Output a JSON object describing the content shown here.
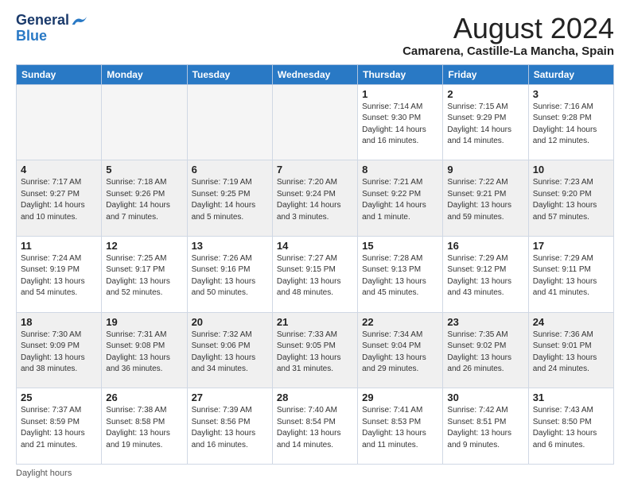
{
  "header": {
    "logo_general": "General",
    "logo_blue": "Blue",
    "month_title": "August 2024",
    "location": "Camarena, Castille-La Mancha, Spain"
  },
  "days_of_week": [
    "Sunday",
    "Monday",
    "Tuesday",
    "Wednesday",
    "Thursday",
    "Friday",
    "Saturday"
  ],
  "footer": {
    "label": "Daylight hours"
  },
  "weeks": [
    [
      {
        "day": "",
        "empty": true
      },
      {
        "day": "",
        "empty": true
      },
      {
        "day": "",
        "empty": true
      },
      {
        "day": "",
        "empty": true
      },
      {
        "day": "1",
        "sunrise": "7:14 AM",
        "sunset": "9:30 PM",
        "daylight": "14 hours and 16 minutes."
      },
      {
        "day": "2",
        "sunrise": "7:15 AM",
        "sunset": "9:29 PM",
        "daylight": "14 hours and 14 minutes."
      },
      {
        "day": "3",
        "sunrise": "7:16 AM",
        "sunset": "9:28 PM",
        "daylight": "14 hours and 12 minutes."
      }
    ],
    [
      {
        "day": "4",
        "sunrise": "7:17 AM",
        "sunset": "9:27 PM",
        "daylight": "14 hours and 10 minutes."
      },
      {
        "day": "5",
        "sunrise": "7:18 AM",
        "sunset": "9:26 PM",
        "daylight": "14 hours and 7 minutes."
      },
      {
        "day": "6",
        "sunrise": "7:19 AM",
        "sunset": "9:25 PM",
        "daylight": "14 hours and 5 minutes."
      },
      {
        "day": "7",
        "sunrise": "7:20 AM",
        "sunset": "9:24 PM",
        "daylight": "14 hours and 3 minutes."
      },
      {
        "day": "8",
        "sunrise": "7:21 AM",
        "sunset": "9:22 PM",
        "daylight": "14 hours and 1 minute."
      },
      {
        "day": "9",
        "sunrise": "7:22 AM",
        "sunset": "9:21 PM",
        "daylight": "13 hours and 59 minutes."
      },
      {
        "day": "10",
        "sunrise": "7:23 AM",
        "sunset": "9:20 PM",
        "daylight": "13 hours and 57 minutes."
      }
    ],
    [
      {
        "day": "11",
        "sunrise": "7:24 AM",
        "sunset": "9:19 PM",
        "daylight": "13 hours and 54 minutes."
      },
      {
        "day": "12",
        "sunrise": "7:25 AM",
        "sunset": "9:17 PM",
        "daylight": "13 hours and 52 minutes."
      },
      {
        "day": "13",
        "sunrise": "7:26 AM",
        "sunset": "9:16 PM",
        "daylight": "13 hours and 50 minutes."
      },
      {
        "day": "14",
        "sunrise": "7:27 AM",
        "sunset": "9:15 PM",
        "daylight": "13 hours and 48 minutes."
      },
      {
        "day": "15",
        "sunrise": "7:28 AM",
        "sunset": "9:13 PM",
        "daylight": "13 hours and 45 minutes."
      },
      {
        "day": "16",
        "sunrise": "7:29 AM",
        "sunset": "9:12 PM",
        "daylight": "13 hours and 43 minutes."
      },
      {
        "day": "17",
        "sunrise": "7:29 AM",
        "sunset": "9:11 PM",
        "daylight": "13 hours and 41 minutes."
      }
    ],
    [
      {
        "day": "18",
        "sunrise": "7:30 AM",
        "sunset": "9:09 PM",
        "daylight": "13 hours and 38 minutes."
      },
      {
        "day": "19",
        "sunrise": "7:31 AM",
        "sunset": "9:08 PM",
        "daylight": "13 hours and 36 minutes."
      },
      {
        "day": "20",
        "sunrise": "7:32 AM",
        "sunset": "9:06 PM",
        "daylight": "13 hours and 34 minutes."
      },
      {
        "day": "21",
        "sunrise": "7:33 AM",
        "sunset": "9:05 PM",
        "daylight": "13 hours and 31 minutes."
      },
      {
        "day": "22",
        "sunrise": "7:34 AM",
        "sunset": "9:04 PM",
        "daylight": "13 hours and 29 minutes."
      },
      {
        "day": "23",
        "sunrise": "7:35 AM",
        "sunset": "9:02 PM",
        "daylight": "13 hours and 26 minutes."
      },
      {
        "day": "24",
        "sunrise": "7:36 AM",
        "sunset": "9:01 PM",
        "daylight": "13 hours and 24 minutes."
      }
    ],
    [
      {
        "day": "25",
        "sunrise": "7:37 AM",
        "sunset": "8:59 PM",
        "daylight": "13 hours and 21 minutes."
      },
      {
        "day": "26",
        "sunrise": "7:38 AM",
        "sunset": "8:58 PM",
        "daylight": "13 hours and 19 minutes."
      },
      {
        "day": "27",
        "sunrise": "7:39 AM",
        "sunset": "8:56 PM",
        "daylight": "13 hours and 16 minutes."
      },
      {
        "day": "28",
        "sunrise": "7:40 AM",
        "sunset": "8:54 PM",
        "daylight": "13 hours and 14 minutes."
      },
      {
        "day": "29",
        "sunrise": "7:41 AM",
        "sunset": "8:53 PM",
        "daylight": "13 hours and 11 minutes."
      },
      {
        "day": "30",
        "sunrise": "7:42 AM",
        "sunset": "8:51 PM",
        "daylight": "13 hours and 9 minutes."
      },
      {
        "day": "31",
        "sunrise": "7:43 AM",
        "sunset": "8:50 PM",
        "daylight": "13 hours and 6 minutes."
      }
    ]
  ]
}
